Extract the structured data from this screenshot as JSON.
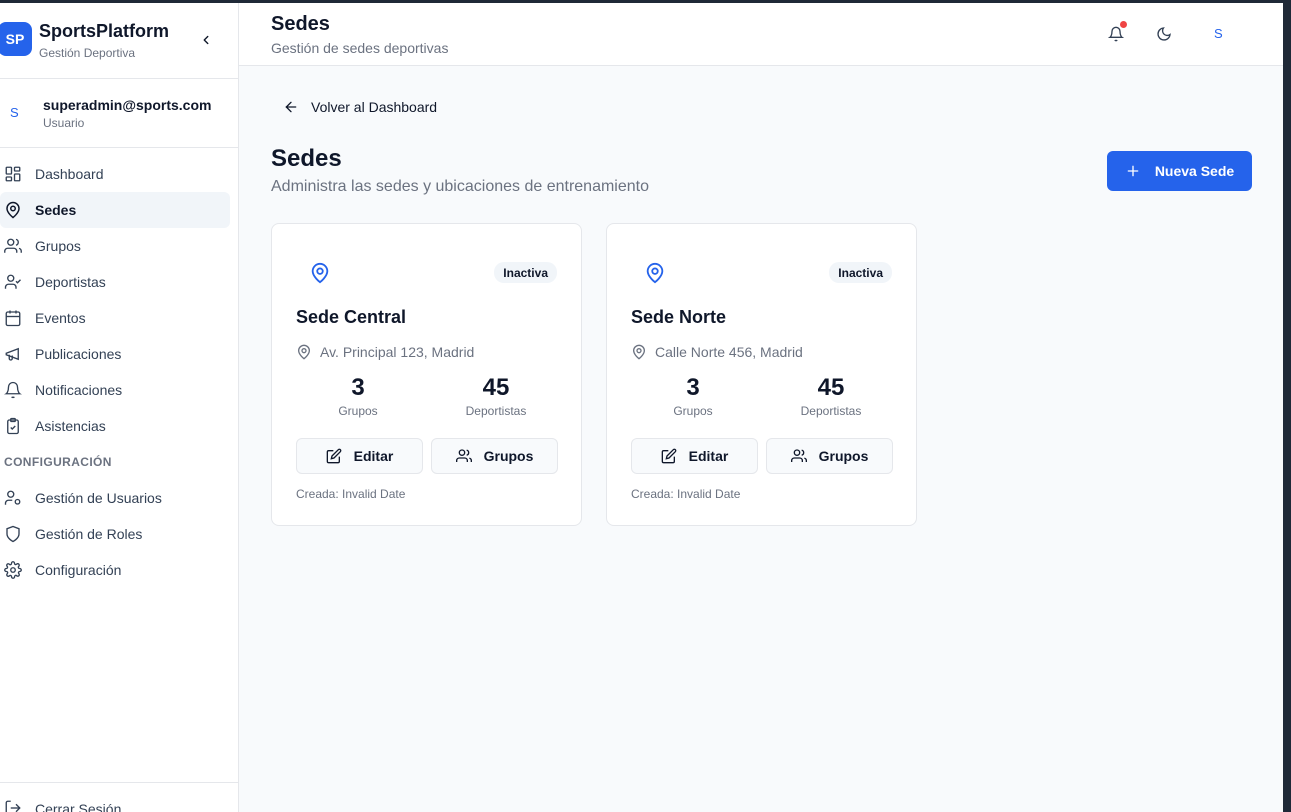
{
  "sidebar": {
    "brand": {
      "logo": "SP",
      "name": "SportsPlatform",
      "subtitle": "Gestión Deportiva"
    },
    "user": {
      "initial": "S",
      "email": "superadmin@sports.com",
      "role": "Usuario"
    },
    "items": [
      {
        "label": "Dashboard",
        "icon": "dashboard-icon"
      },
      {
        "label": "Sedes",
        "icon": "map-pin-icon"
      },
      {
        "label": "Grupos",
        "icon": "users-icon"
      },
      {
        "label": "Deportistas",
        "icon": "user-check-icon"
      },
      {
        "label": "Eventos",
        "icon": "calendar-icon"
      },
      {
        "label": "Publicaciones",
        "icon": "megaphone-icon"
      },
      {
        "label": "Notificaciones",
        "icon": "bell-icon"
      },
      {
        "label": "Asistencias",
        "icon": "clipboard-check-icon"
      }
    ],
    "config_section": "CONFIGURACIÓN",
    "config_items": [
      {
        "label": "Gestión de Usuarios",
        "icon": "user-cog-icon"
      },
      {
        "label": "Gestión de Roles",
        "icon": "shield-icon"
      },
      {
        "label": "Configuración",
        "icon": "gear-icon"
      }
    ],
    "logout": "Cerrar Sesión"
  },
  "header": {
    "title": "Sedes",
    "subtitle": "Gestión de sedes deportivas",
    "avatar_initial": "S"
  },
  "main": {
    "back_label": "Volver al Dashboard",
    "title": "Sedes",
    "subtitle": "Administra las sedes y ubicaciones de entrenamiento",
    "new_button": "Nueva Sede",
    "cards": [
      {
        "badge": "Inactiva",
        "name": "Sede Central",
        "address": "Av. Principal 123, Madrid",
        "groups": "3",
        "groups_label": "Grupos",
        "athletes": "45",
        "athletes_label": "Deportistas",
        "edit_label": "Editar",
        "groups_button": "Grupos",
        "created": "Creada: Invalid Date"
      },
      {
        "badge": "Inactiva",
        "name": "Sede Norte",
        "address": "Calle Norte 456, Madrid",
        "groups": "3",
        "groups_label": "Grupos",
        "athletes": "45",
        "athletes_label": "Deportistas",
        "edit_label": "Editar",
        "groups_button": "Grupos",
        "created": "Creada: Invalid Date"
      }
    ]
  },
  "colors": {
    "accent": "#2563eb",
    "notification_dot": "#ef4444",
    "muted": "#6b7280"
  }
}
